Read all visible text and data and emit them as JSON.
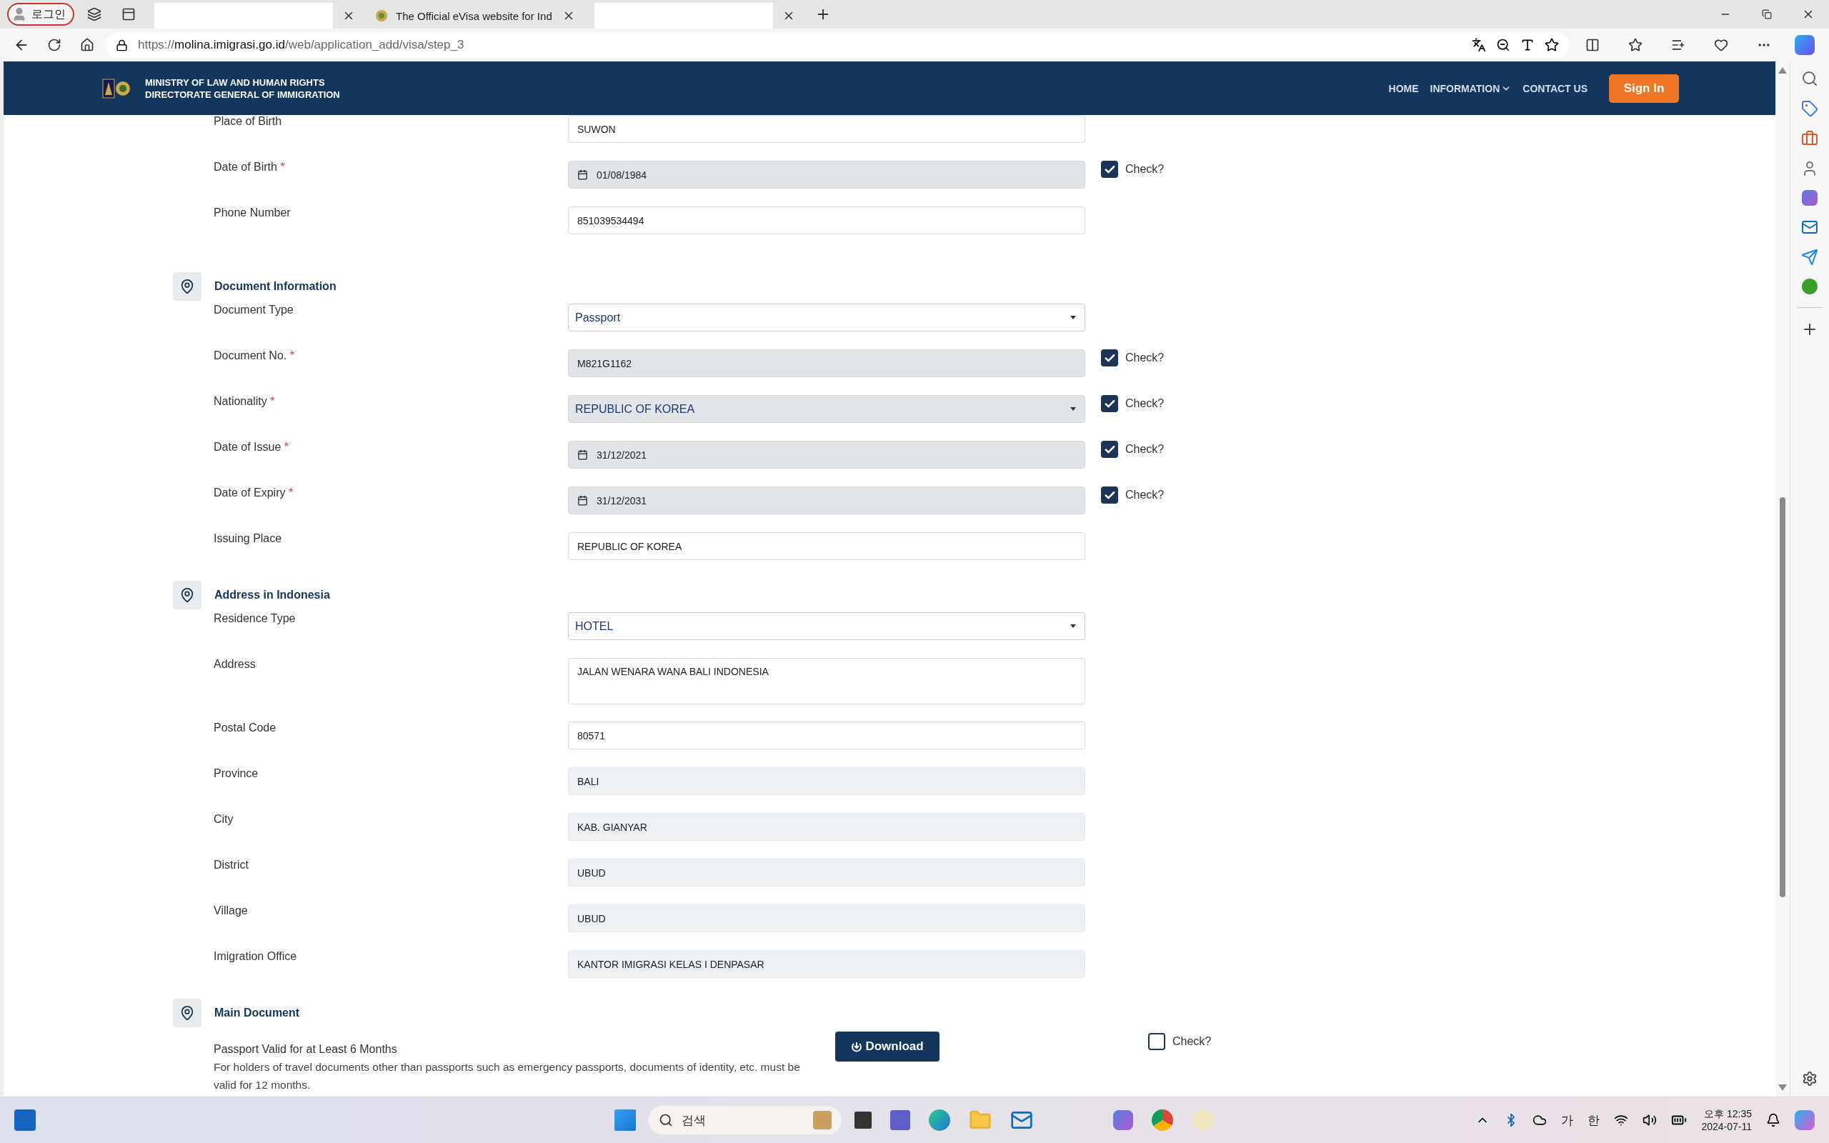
{
  "browser": {
    "profile": "로그인",
    "tabs": [
      {
        "kind": "blank"
      },
      {
        "kind": "page",
        "title": "The Official eVisa website for Ind"
      },
      {
        "kind": "blank"
      }
    ],
    "url": {
      "scheme": "https://",
      "host": "molina.imigrasi.go.id",
      "path": "/web/application_add/visa/step_3"
    }
  },
  "header": {
    "org_lines": [
      "MINISTRY OF  LAW  AND HUMAN RIGHTS",
      "DIRECTORATE GENERAL OF IMMIGRATION"
    ],
    "nav": [
      {
        "label": "HOME",
        "has_menu": false
      },
      {
        "label": "INFORMATION",
        "has_menu": true
      },
      {
        "label": "CONTACT US",
        "has_menu": false
      }
    ],
    "sign_in": "Sign In"
  },
  "form": [
    {
      "kind": "row",
      "label": "Place of Birth",
      "field": {
        "kind": "input",
        "value": "SUWON"
      }
    },
    {
      "kind": "row",
      "label": "Date of Birth",
      "required_mark": "*",
      "field": {
        "kind": "date",
        "value": "01/08/1984"
      },
      "check": {
        "label": "Check?",
        "checked": true
      }
    },
    {
      "kind": "row",
      "label": "Phone Number",
      "field": {
        "kind": "input",
        "value": "851039534494"
      }
    },
    {
      "kind": "section",
      "title": "Document Information"
    },
    {
      "kind": "row",
      "label": "Document Type",
      "field": {
        "kind": "select",
        "value": "Passport"
      }
    },
    {
      "kind": "row",
      "label": "Document No.",
      "required_mark": "*",
      "field": {
        "kind": "disabled",
        "value": "M821G1162"
      },
      "check": {
        "label": "Check?",
        "checked": true
      }
    },
    {
      "kind": "row",
      "label": "Nationality",
      "required_mark": "*",
      "field": {
        "kind": "select",
        "value": "REPUBLIC OF KOREA",
        "disabled": true
      },
      "check": {
        "label": "Check?",
        "checked": true
      }
    },
    {
      "kind": "row",
      "label": "Date of Issue",
      "required_mark": "*",
      "field": {
        "kind": "date",
        "value": "31/12/2021"
      },
      "check": {
        "label": "Check?",
        "checked": true
      }
    },
    {
      "kind": "row",
      "label": "Date of Expiry",
      "required_mark": "*",
      "field": {
        "kind": "date",
        "value": "31/12/2031"
      },
      "check": {
        "label": "Check?",
        "checked": true
      }
    },
    {
      "kind": "row",
      "label": "Issuing Place",
      "field": {
        "kind": "input",
        "value": "REPUBLIC OF KOREA"
      }
    },
    {
      "kind": "section",
      "title": "Address in Indonesia"
    },
    {
      "kind": "row",
      "label": "Residence Type",
      "field": {
        "kind": "select",
        "value": "HOTEL"
      }
    },
    {
      "kind": "row",
      "label": "Address",
      "field": {
        "kind": "textarea",
        "value": "JALAN WENARA WANA BALI INDONESIA"
      }
    },
    {
      "kind": "row",
      "label": "Postal Code",
      "field": {
        "kind": "input",
        "value": "80571"
      }
    },
    {
      "kind": "row",
      "label": "Province",
      "field": {
        "kind": "readonly",
        "value": "BALI"
      }
    },
    {
      "kind": "row",
      "label": "City",
      "field": {
        "kind": "readonly",
        "value": "KAB. GIANYAR"
      }
    },
    {
      "kind": "row",
      "label": "District",
      "field": {
        "kind": "readonly",
        "value": "UBUD"
      }
    },
    {
      "kind": "row",
      "label": "Village",
      "field": {
        "kind": "readonly",
        "value": "UBUD"
      }
    },
    {
      "kind": "row",
      "label": "Imigration Office",
      "field": {
        "kind": "readonly",
        "value": "KANTOR IMIGRASI KELAS I DENPASAR"
      }
    },
    {
      "kind": "section",
      "title": "Main Document"
    },
    {
      "kind": "document",
      "title": "Passport Valid for at Least 6 Months",
      "note": "For holders of travel documents other than passports such as emergency passports, documents of identity, etc. must be valid for 12 months.",
      "button": "Download",
      "check": {
        "label": "Check?",
        "checked": false
      }
    }
  ],
  "taskbar": {
    "search_placeholder": "검색",
    "ime": [
      "가",
      "한"
    ],
    "time": "오후 12:35",
    "date": "2024-07-11"
  }
}
